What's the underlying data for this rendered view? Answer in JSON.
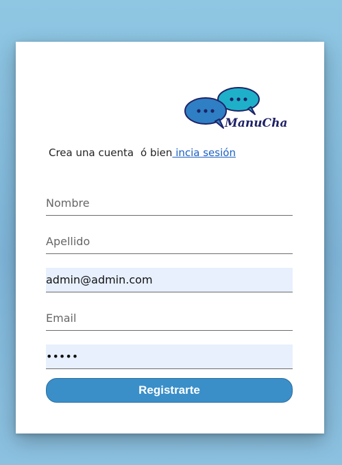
{
  "brand": {
    "name": "ManuChat",
    "logo_colors": {
      "front_bubble": "#2f7fc4",
      "back_bubble": "#1fb0c9",
      "outline": "#1f2266"
    }
  },
  "intro": {
    "text": "Crea una cuenta",
    "connector": "ó bien",
    "link_label": " incia sesión"
  },
  "form": {
    "nombre": {
      "placeholder": "Nombre",
      "value": ""
    },
    "apellido": {
      "placeholder": "Apellido",
      "value": ""
    },
    "username": {
      "value": "admin@admin.com"
    },
    "email": {
      "placeholder": "Email",
      "value": ""
    },
    "password": {
      "value": "admin"
    }
  },
  "submit_label": "Registrarte",
  "colors": {
    "button": "#3a8fc9",
    "link": "#1a5fc2",
    "autofill_bg": "#e8f0fe"
  }
}
